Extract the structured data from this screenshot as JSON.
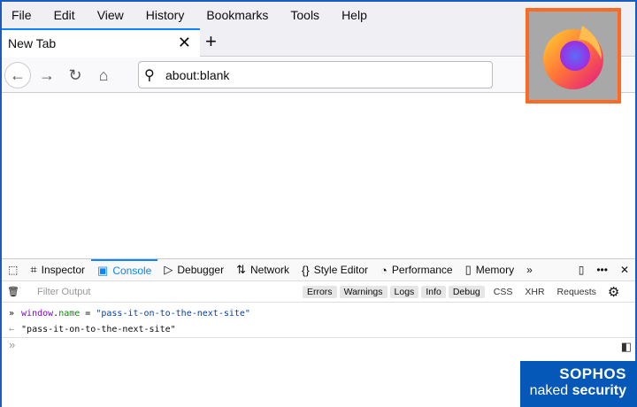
{
  "menu": [
    "File",
    "Edit",
    "View",
    "History",
    "Bookmarks",
    "Tools",
    "Help"
  ],
  "tab": {
    "title": "New Tab",
    "close": "✕",
    "new": "+"
  },
  "url": "about:blank",
  "devtools": {
    "tabs": [
      "Inspector",
      "Console",
      "Debugger",
      "Network",
      "Style Editor",
      "Performance",
      "Memory"
    ],
    "active": "Console",
    "filter_placeholder": "Filter Output",
    "levels": [
      "Errors",
      "Warnings",
      "Logs",
      "Info",
      "Debug"
    ],
    "types": [
      "CSS",
      "XHR",
      "Requests"
    ]
  },
  "console": {
    "kw": "window",
    "dot": ".",
    "prop": "name",
    "eq": " = ",
    "str": "\"pass-it-on-to-the-next-site\"",
    "result": "\"pass-it-on-to-the-next-site\""
  },
  "watermark": {
    "brand": "SOPHOS",
    "line1": "naked",
    "line2": "security"
  }
}
